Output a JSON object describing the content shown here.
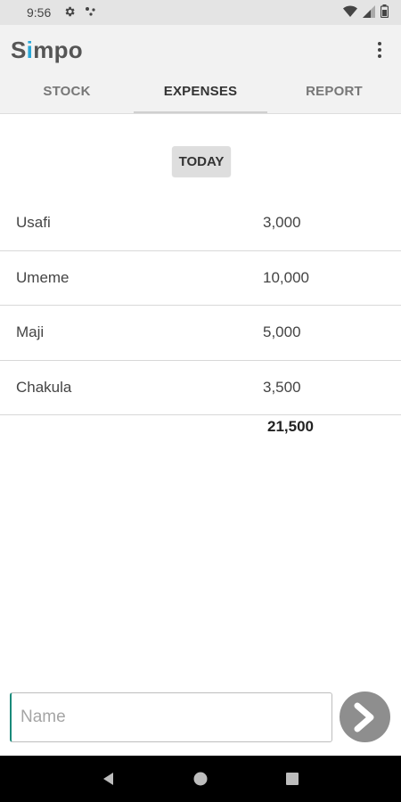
{
  "status_bar": {
    "time": "9:56",
    "icons": [
      "settings-icon",
      "cast-icon",
      "wifi-icon",
      "signal-icon",
      "battery-icon"
    ]
  },
  "app_bar": {
    "title_prefix": "S",
    "title_accent": "i",
    "title_suffix": "mpo",
    "accent_color": "#29a8d9",
    "menu_icon": "more-vertical-icon"
  },
  "tabs": [
    {
      "label": "STOCK",
      "active": false
    },
    {
      "label": "EXPENSES",
      "active": true
    },
    {
      "label": "REPORT",
      "active": false
    }
  ],
  "filter_button": "TODAY",
  "expenses": [
    {
      "name": "Usafi",
      "amount": "3,000"
    },
    {
      "name": "Umeme",
      "amount": "10,000"
    },
    {
      "name": "Maji",
      "amount": "5,000"
    },
    {
      "name": "Chakula",
      "amount": "3,500"
    }
  ],
  "total": "21,500",
  "input": {
    "placeholder": "Name",
    "value": ""
  },
  "next_button_icon": "chevron-right-icon",
  "nav_bar": {
    "icons": [
      "back-icon",
      "home-icon",
      "recents-icon"
    ]
  }
}
